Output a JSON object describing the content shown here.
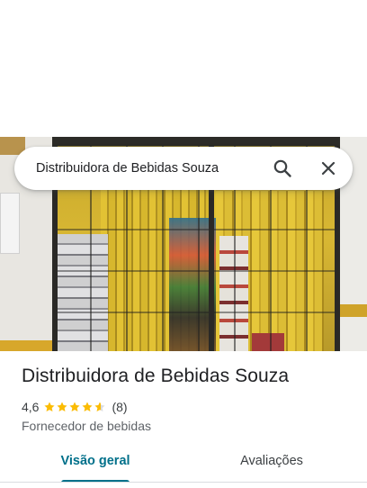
{
  "search": {
    "query": "Distribuidora de Bebidas Souza",
    "search_icon": "search-icon",
    "close_icon": "close-icon"
  },
  "place": {
    "name": "Distribuidora de Bebidas Souza",
    "rating": "4,6",
    "rating_value": 4.6,
    "stars_max": 5,
    "review_count": "(8)",
    "category": "Fornecedor de bebidas"
  },
  "tabs": [
    {
      "label": "Visão geral",
      "selected": true
    },
    {
      "label": "Avaliações",
      "selected": false
    }
  ],
  "colors": {
    "accent": "#00708a",
    "star": "#fbbc04",
    "star_empty": "#dadce0"
  }
}
